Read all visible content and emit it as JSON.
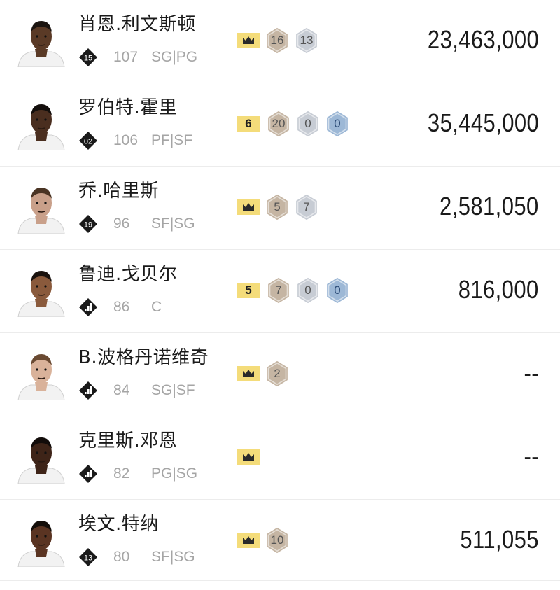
{
  "players": [
    {
      "name": "肖恩.利文斯顿",
      "badge": "15",
      "badge_type": "number",
      "rating": "107",
      "positions": "SG|PG",
      "chips": [
        {
          "type": "crown"
        },
        {
          "type": "tan",
          "value": "16"
        },
        {
          "type": "gray",
          "value": "13"
        }
      ],
      "price": "23,463,000",
      "skin": "#5a3a26",
      "hair": "#1b1410"
    },
    {
      "name": "罗伯特.霍里",
      "badge": "02",
      "badge_type": "number",
      "rating": "106",
      "positions": "PF|SF",
      "chips": [
        {
          "type": "gold",
          "value": "6"
        },
        {
          "type": "tan",
          "value": "20"
        },
        {
          "type": "gray",
          "value": "0"
        },
        {
          "type": "blue",
          "value": "0"
        }
      ],
      "price": "35,445,000",
      "skin": "#4a2e1f",
      "hair": "#140f0c"
    },
    {
      "name": "乔.哈里斯",
      "badge": "19",
      "badge_type": "number",
      "rating": "96",
      "positions": "SF|SG",
      "chips": [
        {
          "type": "crown"
        },
        {
          "type": "tan",
          "value": "5"
        },
        {
          "type": "gray",
          "value": "7"
        }
      ],
      "price": "2,581,050",
      "skin": "#c9a08a",
      "hair": "#4a3424"
    },
    {
      "name": "鲁迪.戈贝尔",
      "badge": "",
      "badge_type": "bars",
      "rating": "86",
      "positions": "C",
      "chips": [
        {
          "type": "gold",
          "value": "5"
        },
        {
          "type": "tan",
          "value": "7"
        },
        {
          "type": "gray",
          "value": "0"
        },
        {
          "type": "blue",
          "value": "0"
        }
      ],
      "price": "816,000",
      "skin": "#8a5a3c",
      "hair": "#1a120e"
    },
    {
      "name": "B.波格丹诺维奇",
      "badge": "",
      "badge_type": "bars",
      "rating": "84",
      "positions": "SG|SF",
      "chips": [
        {
          "type": "crown"
        },
        {
          "type": "tan",
          "value": "2"
        }
      ],
      "price": "--",
      "skin": "#d9b29a",
      "hair": "#6a4a32"
    },
    {
      "name": "克里斯.邓恩",
      "badge": "",
      "badge_type": "bars",
      "rating": "82",
      "positions": "PG|SG",
      "chips": [
        {
          "type": "crown"
        }
      ],
      "price": "--",
      "skin": "#3e2418",
      "hair": "#120c0a"
    },
    {
      "name": "埃文.特纳",
      "badge": "13",
      "badge_type": "number",
      "rating": "80",
      "positions": "SF|SG",
      "chips": [
        {
          "type": "crown"
        },
        {
          "type": "tan",
          "value": "10"
        }
      ],
      "price": "511,055",
      "skin": "#5a3422",
      "hair": "#140e0a"
    }
  ],
  "colors": {
    "gold": "#f4dc7a",
    "tan": "#c5b5a3",
    "gray": "#c7ccd4",
    "blue": "#9db8d6",
    "badge": "#1a1a1a",
    "muted": "#a5a5a5"
  }
}
